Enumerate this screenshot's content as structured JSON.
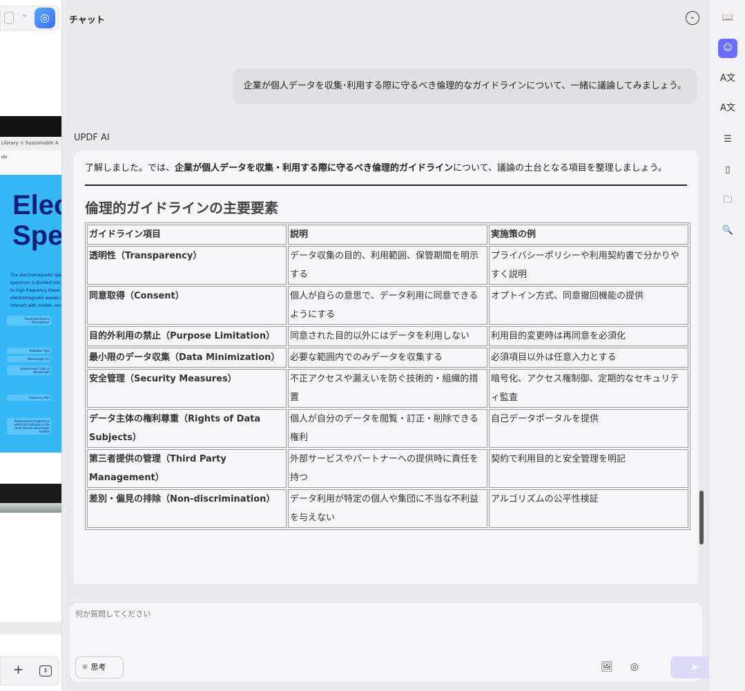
{
  "left_panel": {
    "tabs": "Library   ×   Sustainable A",
    "tools": "ols",
    "poster_title": "Elec Spe",
    "poster_text": [
      "The electromagnetic spec",
      "spectrum is divided into s",
      "to high frequency these a",
      "electromagnetic waves in",
      "interact with matter, and t"
    ],
    "labels": [
      "Penetrates Earth's Atmosphere?",
      "Radiation Type",
      "Wavelength (m)",
      "Approximate Scale of Wavelength",
      "Frequency (Hz)",
      "Temperature of objects at which this radiation is the most intense wavelength emitted"
    ]
  },
  "header": {
    "title": "チャット"
  },
  "user_message": "企業が個人データを収集･利用する際に守るべき倫理的なガイドラインについて、一緒に議論してみましょう。",
  "assistant": {
    "name": "UPDF AI",
    "intro_pre": "了解しました。では、",
    "intro_bold": "企業が個人データを収集・利用する際に守るべき倫理的ガイドライン",
    "intro_post": "について、議論の土台となる項目を整理しましょう。",
    "heading": "倫理的ガイドラインの主要要素",
    "table": {
      "headers": [
        "ガイドライン項目",
        "説明",
        "実施策の例"
      ],
      "rows": [
        [
          "透明性（Transparency）",
          "データ収集の目的、利用範囲、保管期間を明示する",
          "プライバシーポリシーや利用契約書で分かりやすく説明"
        ],
        [
          "同意取得（Consent）",
          "個人が自らの意思で、データ利用に同意できるようにする",
          "オプトイン方式、同意撤回機能の提供"
        ],
        [
          "目的外利用の禁止（Purpose Limitation）",
          "同意された目的以外にはデータを利用しない",
          "利用目的変更時は再同意を必須化"
        ],
        [
          "最小限のデータ収集（Data Minimization）",
          "必要な範囲内でのみデータを収集する",
          "必須項目以外は任意入力とする"
        ],
        [
          "安全管理（Security Measures）",
          "不正アクセスや漏えいを防ぐ技術的・組織的措置",
          "暗号化、アクセス権制御、定期的なセキュリティ監査"
        ],
        [
          "データ主体の権利尊重（Rights of Data Subjects）",
          "個人が自分のデータを閲覧・訂正・削除できる権利",
          "自己データポータルを提供"
        ],
        [
          "第三者提供の管理（Third Party Management）",
          "外部サービスやパートナーへの提供時に責任を持つ",
          "契約で利用目的と安全管理を明記"
        ],
        [
          "差別・偏見の排除（Non-discrimination）",
          "データ利用が特定の個人や集団に不当な不利益を与えない",
          "アルゴリズムの公平性検証"
        ]
      ]
    }
  },
  "input": {
    "placeholder": "何か質問してください",
    "think_label": "思考"
  },
  "colors": {
    "accent": "#6b6ef7",
    "send_disabled": "#dcdcf8"
  }
}
